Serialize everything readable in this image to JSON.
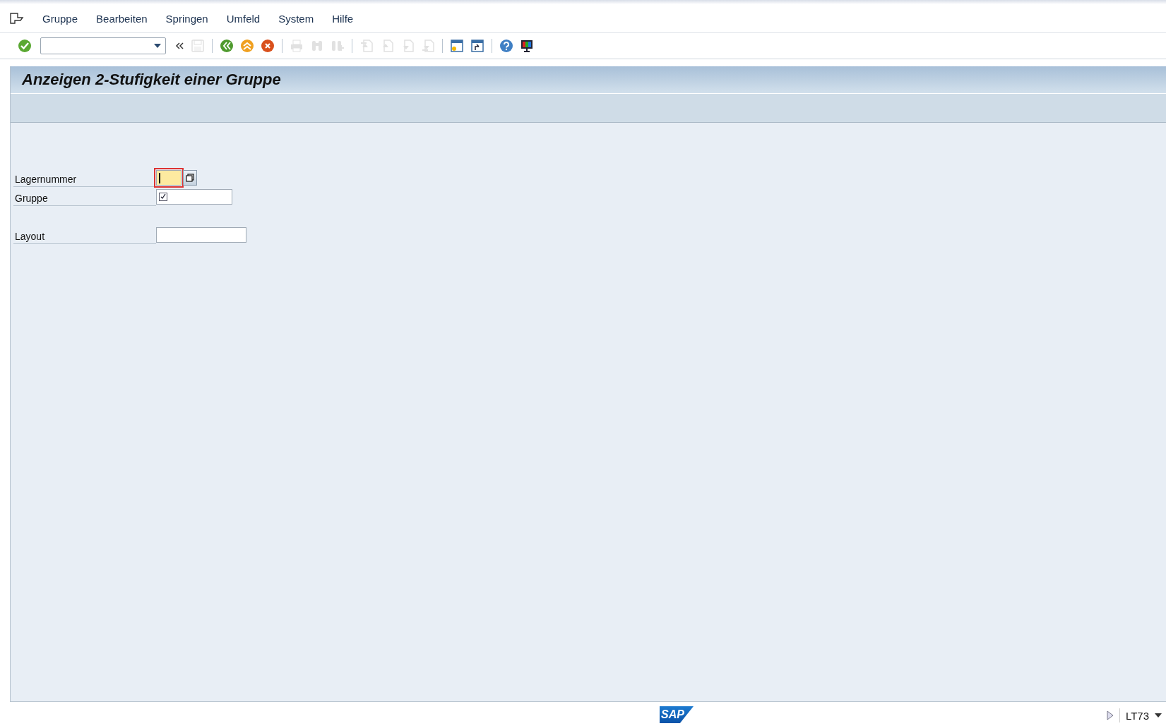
{
  "menu_bar": {
    "items": [
      "Gruppe",
      "Bearbeiten",
      "Springen",
      "Umfeld",
      "System",
      "Hilfe"
    ]
  },
  "toolbar": {
    "items": [
      {
        "kind": "enter",
        "disabled": false
      },
      {
        "kind": "command"
      },
      {
        "kind": "collapse",
        "disabled": false
      },
      {
        "kind": "save",
        "disabled": true
      },
      {
        "kind": "sep"
      },
      {
        "kind": "back",
        "disabled": false
      },
      {
        "kind": "exit",
        "disabled": false
      },
      {
        "kind": "cancel",
        "disabled": false
      },
      {
        "kind": "sep"
      },
      {
        "kind": "print",
        "disabled": true
      },
      {
        "kind": "find",
        "disabled": true
      },
      {
        "kind": "findnext",
        "disabled": true
      },
      {
        "kind": "sep"
      },
      {
        "kind": "first",
        "disabled": true
      },
      {
        "kind": "prev",
        "disabled": true
      },
      {
        "kind": "next",
        "disabled": true
      },
      {
        "kind": "last",
        "disabled": true
      },
      {
        "kind": "sep"
      },
      {
        "kind": "session",
        "disabled": false
      },
      {
        "kind": "shortcut",
        "disabled": false
      },
      {
        "kind": "sep"
      },
      {
        "kind": "help",
        "disabled": false
      },
      {
        "kind": "layout",
        "disabled": false
      }
    ]
  },
  "screen": {
    "title": "Anzeigen 2-Stufigkeit einer Gruppe"
  },
  "form": {
    "fields": [
      {
        "label": "Lagernummer",
        "kind": "short",
        "focused": true,
        "value_help": true,
        "required": false,
        "gap_before": false
      },
      {
        "label": "Gruppe",
        "kind": "medium",
        "focused": false,
        "value_help": false,
        "required": true,
        "gap_before": false
      },
      {
        "label": "Layout",
        "kind": "long",
        "focused": false,
        "value_help": false,
        "required": false,
        "gap_before": true
      }
    ]
  },
  "status_bar": {
    "logo": "SAP",
    "transaction": "LT73"
  }
}
